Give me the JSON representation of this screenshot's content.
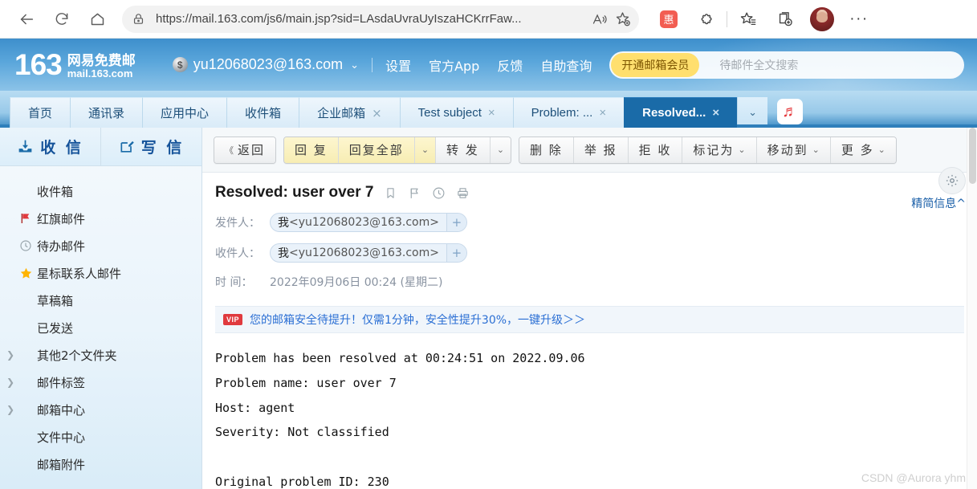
{
  "browser": {
    "url": "https://mail.163.com/js6/main.jsp?sid=LAsdaUvraUyIszaHCKrrFaw...",
    "back_label": "←",
    "refresh_label": "⟳",
    "home_label": "⌂",
    "read_aloud_label": "A",
    "favorite_label": "☆",
    "extension_badge_label": "惠",
    "menu_label": "···"
  },
  "header": {
    "logo_number": "163",
    "logo_cn": "网易免费邮",
    "logo_en": "mail.163.com",
    "account_email": "yu12068023@163.com",
    "coin_label": "$",
    "caret": "⌄",
    "links": [
      "设置",
      "官方App",
      "反馈",
      "自助查询"
    ],
    "vip_pill": "开通邮箱会员",
    "search_placeholder": "待邮件全文搜索"
  },
  "tabs": [
    {
      "label": "首页",
      "closable": false,
      "active": false,
      "latin": false
    },
    {
      "label": "通讯录",
      "closable": false,
      "active": false,
      "latin": false
    },
    {
      "label": "应用中心",
      "closable": false,
      "active": false,
      "latin": false
    },
    {
      "label": "收件箱",
      "closable": false,
      "active": false,
      "latin": false
    },
    {
      "label": "企业邮箱",
      "closable": true,
      "active": false,
      "latin": false
    },
    {
      "label": "Test subject",
      "closable": true,
      "active": false,
      "latin": true
    },
    {
      "label": "Problem: ...",
      "closable": true,
      "active": false,
      "latin": true
    },
    {
      "label": "Resolved...",
      "closable": true,
      "active": true,
      "latin": true
    }
  ],
  "tab_close_label": "×",
  "tab_overflow_label": "⌄",
  "music_icon_label": "♬",
  "sidebar": {
    "receive_label": "收 信",
    "compose_label": "写 信",
    "folders": [
      {
        "label": "收件箱",
        "icon": "none",
        "arrow": false
      },
      {
        "label": "红旗邮件",
        "icon": "red-flag",
        "arrow": false
      },
      {
        "label": "待办邮件",
        "icon": "clock",
        "arrow": false
      },
      {
        "label": "星标联系人邮件",
        "icon": "star",
        "arrow": false
      },
      {
        "label": "草稿箱",
        "icon": "none",
        "arrow": false
      },
      {
        "label": "已发送",
        "icon": "none",
        "arrow": false
      },
      {
        "label": "其他2个文件夹",
        "icon": "none",
        "arrow": true
      },
      {
        "label": "邮件标签",
        "icon": "none",
        "arrow": true
      },
      {
        "label": "邮箱中心",
        "icon": "none",
        "arrow": true
      },
      {
        "label": "文件中心",
        "icon": "none",
        "arrow": false
      },
      {
        "label": "邮箱附件",
        "icon": "none",
        "arrow": false
      }
    ],
    "arrow_glyph": "❯"
  },
  "toolbar": {
    "back_label": "返回",
    "back_arrow": "《",
    "reply_label": "回 复",
    "reply_all_label": "回复全部",
    "forward_label": "转 发",
    "delete_label": "删 除",
    "report_label": "举 报",
    "reject_label": "拒 收",
    "mark_as_label": "标记为",
    "move_to_label": "移动到",
    "more_label": "更 多",
    "caret": "⌄"
  },
  "message": {
    "subject": "Resolved: user over 7",
    "from_label": "发件人：",
    "from_name": "我",
    "from_address": "<yu12068023@163.com>",
    "to_label": "收件人：",
    "to_name": "我",
    "to_address": "<yu12068023@163.com>",
    "time_label": "时  间：",
    "time_value": "2022年09月06日 00:24 (星期二)",
    "add_contact_label": "+",
    "vip_tag": "VIP",
    "vip_text": "您的邮箱安全待提升！仅需1分钟，安全性提升30%，一键升级＞＞",
    "body": "Problem has been resolved at 00:24:51 on 2022.09.06\nProblem name: user over 7\nHost: agent\nSeverity: Not classified\n\nOriginal problem ID: 230",
    "gear_label": "⚙",
    "simplify_label": "精简信息^"
  },
  "watermark": "CSDN @Aurora yhm",
  "colors": {
    "header_blue": "#5aa6db",
    "active_tab": "#1a6ba8",
    "vip_yellow": "#ffdf6e",
    "link_blue": "#2b6fd4",
    "red_flag": "#e03a3e"
  }
}
